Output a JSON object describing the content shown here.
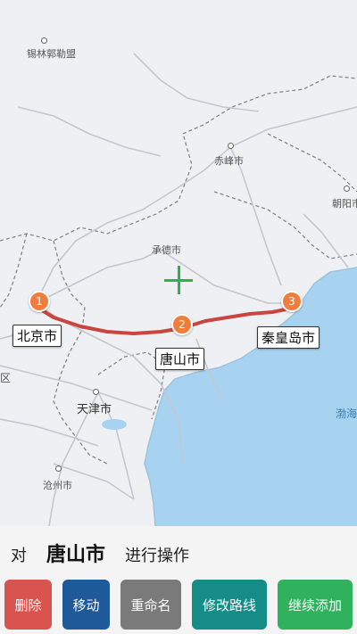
{
  "map": {
    "cities": [
      {
        "name": "锡林郭勒盟"
      },
      {
        "name": "赤峰市"
      },
      {
        "name": "朝阳市"
      },
      {
        "name": "承德市"
      },
      {
        "name": "天津市"
      },
      {
        "name": "沧州市"
      },
      {
        "name": "渤海"
      },
      {
        "name": "区"
      }
    ],
    "waypoints": [
      {
        "number": "1",
        "name": "北京市"
      },
      {
        "number": "2",
        "name": "唐山市"
      },
      {
        "number": "3",
        "name": "秦皇岛市"
      }
    ],
    "route_color": "#c9453f",
    "pin_color": "#ef7d3c",
    "crosshair_color": "#2fb24c",
    "crosshair_icon": "crosshair-plus-icon"
  },
  "panel": {
    "prefix": "对",
    "selected_city": "唐山市",
    "suffix": "进行操作"
  },
  "buttons": [
    {
      "label": "删除",
      "color": "#d9534f"
    },
    {
      "label": "移动",
      "color": "#1e5a99"
    },
    {
      "label": "重命名",
      "color": "#7a7a7a"
    },
    {
      "label": "修改路线",
      "color": "#168c89"
    },
    {
      "label": "继续添加",
      "color": "#2fb15d"
    }
  ]
}
